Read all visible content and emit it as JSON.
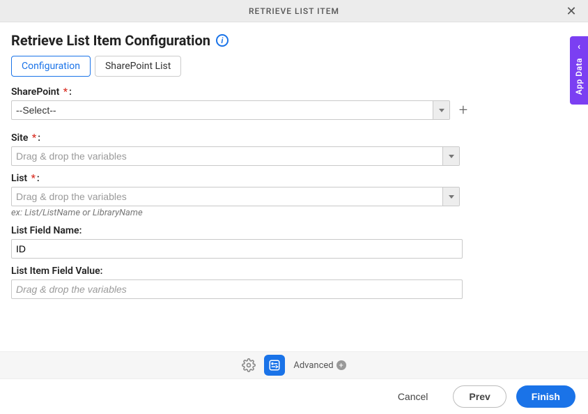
{
  "titlebar": {
    "title": "RETRIEVE LIST ITEM"
  },
  "heading": {
    "title": "Retrieve List Item Configuration",
    "info": "i"
  },
  "tabs": [
    {
      "label": "Configuration",
      "active": true
    },
    {
      "label": "SharePoint List",
      "active": false
    }
  ],
  "fields": {
    "sharepoint": {
      "label": "SharePoint",
      "required": true,
      "value": "--Select--",
      "placeholder": ""
    },
    "site": {
      "label": "Site",
      "required": true,
      "value": "",
      "placeholder": "Drag & drop the variables"
    },
    "list": {
      "label": "List",
      "required": true,
      "value": "",
      "placeholder": "Drag & drop the variables",
      "hint": "ex: List/ListName or LibraryName"
    },
    "field_name": {
      "label": "List Field Name:",
      "required": false,
      "value": "ID",
      "placeholder": ""
    },
    "field_value": {
      "label": "List Item Field Value:",
      "required": false,
      "value": "",
      "placeholder": "Drag & drop the variables"
    }
  },
  "util": {
    "advanced_label": "Advanced"
  },
  "footer": {
    "cancel": "Cancel",
    "prev": "Prev",
    "finish": "Finish"
  },
  "side_tab": {
    "label": "App Data"
  },
  "colors": {
    "primary": "#1a73e8",
    "accent": "#7b3ff2",
    "danger": "#d93025"
  }
}
